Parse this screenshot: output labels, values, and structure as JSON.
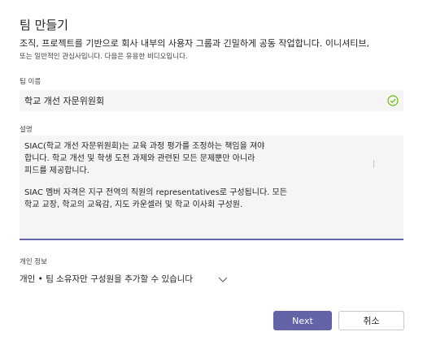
{
  "dialog": {
    "title": "팀 만들기",
    "description_line1": "조직, 프로젝트를 기반으로 회사 내부의 사용자 그룹과 긴밀하게 공동 작업합니다. 이니셔티브,",
    "description_line2": "또는 일반적인 관심사입니다. 다음은 유용한 비디오입니다."
  },
  "team_name": {
    "label": "팀 이름",
    "value": "학교 개선 자문위원회",
    "status_icon": "check-circle-icon",
    "status_color": "#6bb700"
  },
  "description": {
    "label": "설명",
    "paragraph1": "SIAC(학교 개선 자문위원회)는 교육 과정 평가를 조정하는 책임을 져야\n합니다. 학교 개선 및 학생 도전 과제와 관련된 모든 문제뿐만 아니라\n피드를 제공합니다.",
    "paragraph2": "SIAC 멤버 자격은 지구 전역의 직원의 representatives로 구성됩니다. 모든\n학교 교장, 학교의 교육감, 지도 카운셀러 및 학교 이사회 구성원."
  },
  "privacy": {
    "label": "개인 정보",
    "selected": "개인 • 팀 소유자만 구성원을 추가할 수 있습니다",
    "icon": "chevron-down-icon"
  },
  "buttons": {
    "next": "Next",
    "cancel": "취소"
  },
  "colors": {
    "accent": "#6264a7"
  }
}
